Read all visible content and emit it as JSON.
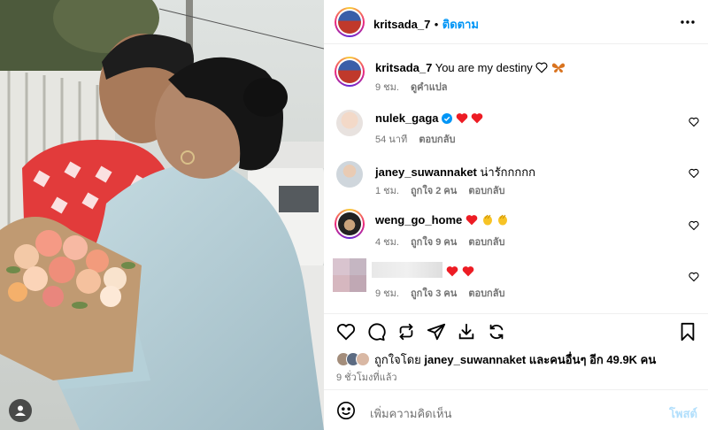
{
  "post_header": {
    "username": "kritsada_7",
    "separator": "•",
    "follow_label": "ติดตาม"
  },
  "caption": {
    "username": "kritsada_7",
    "text": "You are my destiny",
    "time": "9 ชม.",
    "translate_label": "ดูคำแปล"
  },
  "comments": [
    {
      "username": "nulek_gaga",
      "text": "",
      "time": "54 นาที",
      "likes": "",
      "reply_label": "ตอบกลับ"
    },
    {
      "username": "janey_suwannaket",
      "text": "น่ารักกกกก",
      "time": "1 ชม.",
      "likes": "ถูกใจ 2 คน",
      "reply_label": "ตอบกลับ"
    },
    {
      "username": "weng_go_home",
      "text": "",
      "time": "4 ชม.",
      "likes": "ถูกใจ 9 คน",
      "reply_label": "ตอบกลับ"
    },
    {
      "username": "",
      "text": "",
      "time": "9 ชม.",
      "likes": "ถูกใจ 3 คน",
      "reply_label": "ตอบกลับ"
    }
  ],
  "likes": {
    "prefix": "ถูกใจโดย ",
    "user": "janey_suwannaket",
    "suffix": " และคนอื่นๆ อีก 49.9K คน"
  },
  "time_ago": "9 ชั่วโมงที่แล้ว",
  "add_comment": {
    "placeholder": "เพิ่มความคิดเห็น",
    "post_label": "โพสต์"
  },
  "icons": {
    "more": "more-options-icon",
    "like": "heart-icon",
    "comment": "comment-icon",
    "repost": "repost-icon",
    "share": "share-icon",
    "save": "save-icon",
    "bookmark": "bookmark-icon"
  },
  "colors": {
    "accent": "#0095f6",
    "heart": "#ed1c24",
    "muted": "#737373",
    "post_disabled": "#b2dffc"
  }
}
